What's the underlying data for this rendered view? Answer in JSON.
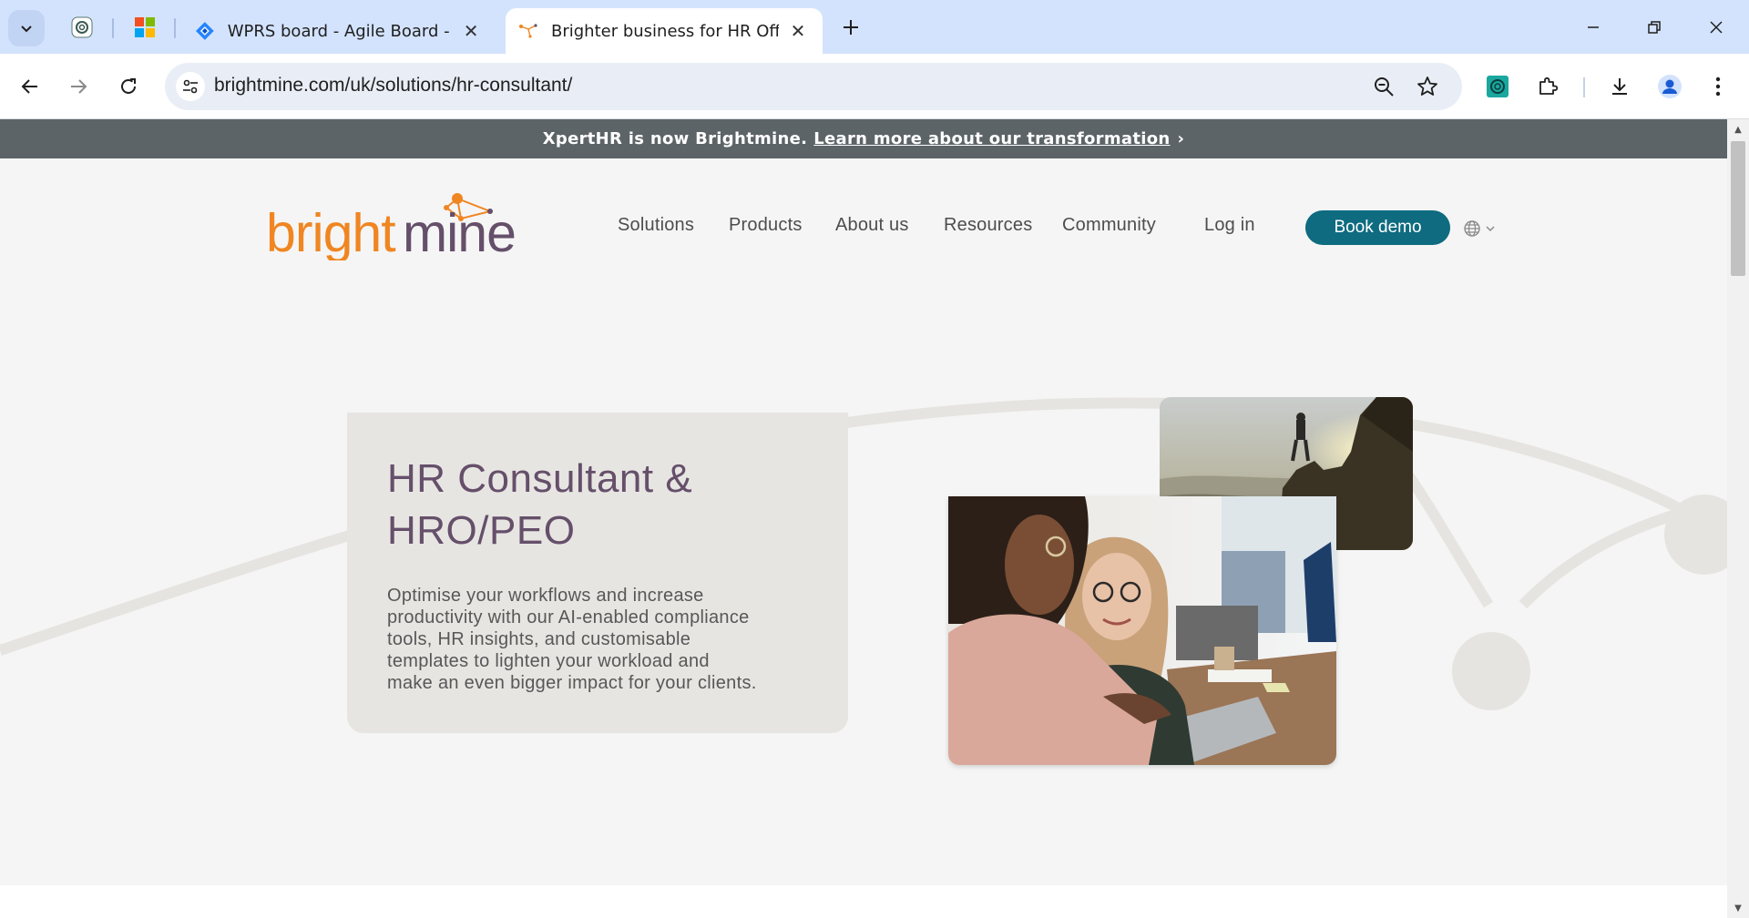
{
  "browser": {
    "tabs": [
      {
        "label": "WPRS board - Agile Board - CE",
        "active": false
      },
      {
        "label": "Brighter business for HR Office",
        "active": true
      }
    ],
    "url": "brightmine.com/uk/solutions/hr-consultant/",
    "pinned_tabs": [
      "chatgpt-icon",
      "microsoft-icon"
    ]
  },
  "banner": {
    "text": "XpertHR is now Brightmine.",
    "link": "Learn more about our transformation",
    "chevron": "›"
  },
  "site": {
    "logo_text": "brightmine",
    "nav": [
      "Solutions",
      "Products",
      "About us",
      "Resources",
      "Community"
    ],
    "login": "Log in",
    "cta": "Book demo",
    "brand_colors": {
      "orange": "#ef8622",
      "teal": "#0e6b80",
      "purple": "#654f6a"
    }
  },
  "hero": {
    "title_line1": "HR Consultant &",
    "title_line2": "HRO/PEO",
    "body_lines": [
      "Optimise your workflows and increase",
      "productivity with our AI-enabled compliance",
      "tools, HR insights, and customisable",
      "templates to lighten your workload and",
      "make an even bigger impact for your clients."
    ]
  }
}
